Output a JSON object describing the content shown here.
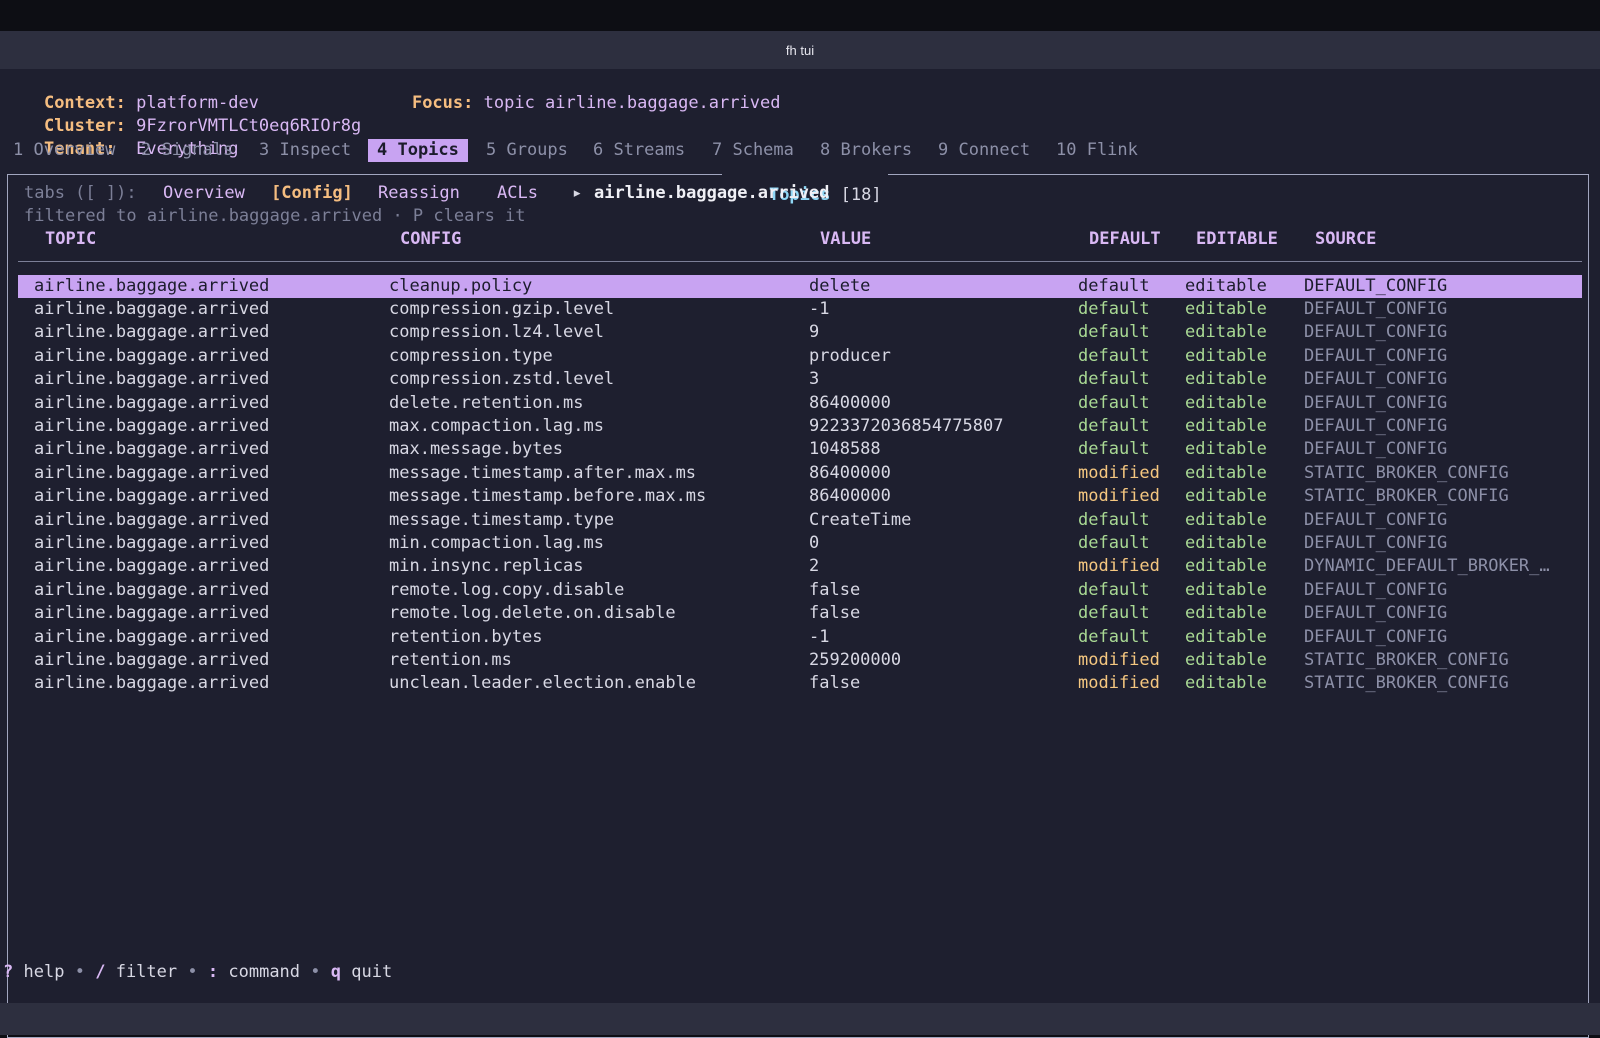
{
  "window": {
    "title": "fh tui"
  },
  "header": {
    "context_label": "Context:",
    "context_value": "platform-dev",
    "focus_label": "Focus:",
    "focus_value": "topic airline.baggage.arrived",
    "cluster_label": "Cluster:",
    "cluster_value": "9FzrorVMTLCt0eq6RIOr8g",
    "tenant_label": "Tenant:",
    "tenant_value": "Everything"
  },
  "nav_tabs": [
    {
      "label": "1 Overview",
      "active": false
    },
    {
      "label": "2 Signals",
      "active": false
    },
    {
      "label": "3 Inspect",
      "active": false
    },
    {
      "label": "4 Topics",
      "active": true
    },
    {
      "label": "5 Groups",
      "active": false
    },
    {
      "label": "6 Streams",
      "active": false
    },
    {
      "label": "7 Schema",
      "active": false
    },
    {
      "label": "8 Brokers",
      "active": false
    },
    {
      "label": "9 Connect",
      "active": false
    },
    {
      "label": "10 Flink",
      "active": false
    }
  ],
  "panel": {
    "title": "Topics",
    "count": "[18]",
    "subtabs_prefix": "tabs ([ ]):",
    "subtabs": [
      {
        "label": "Overview",
        "active": false
      },
      {
        "label": "[Config]",
        "active": true
      },
      {
        "label": "Reassign",
        "active": false
      },
      {
        "label": "ACLs",
        "active": false
      }
    ],
    "breadcrumb_arrow": "▸",
    "breadcrumb_topic": "airline.baggage.arrived",
    "filter_note": "filtered to airline.baggage.arrived · P clears it"
  },
  "table": {
    "columns": [
      "TOPIC",
      "CONFIG",
      "VALUE",
      "DEFAULT",
      "EDITABLE",
      "SOURCE"
    ],
    "selected_index": 0,
    "rows": [
      {
        "topic": "airline.baggage.arrived",
        "config": "cleanup.policy",
        "value": "delete",
        "default": "default",
        "editable": "editable",
        "source": "DEFAULT_CONFIG"
      },
      {
        "topic": "airline.baggage.arrived",
        "config": "compression.gzip.level",
        "value": "-1",
        "default": "default",
        "editable": "editable",
        "source": "DEFAULT_CONFIG"
      },
      {
        "topic": "airline.baggage.arrived",
        "config": "compression.lz4.level",
        "value": "9",
        "default": "default",
        "editable": "editable",
        "source": "DEFAULT_CONFIG"
      },
      {
        "topic": "airline.baggage.arrived",
        "config": "compression.type",
        "value": "producer",
        "default": "default",
        "editable": "editable",
        "source": "DEFAULT_CONFIG"
      },
      {
        "topic": "airline.baggage.arrived",
        "config": "compression.zstd.level",
        "value": "3",
        "default": "default",
        "editable": "editable",
        "source": "DEFAULT_CONFIG"
      },
      {
        "topic": "airline.baggage.arrived",
        "config": "delete.retention.ms",
        "value": "86400000",
        "default": "default",
        "editable": "editable",
        "source": "DEFAULT_CONFIG"
      },
      {
        "topic": "airline.baggage.arrived",
        "config": "max.compaction.lag.ms",
        "value": "9223372036854775807",
        "default": "default",
        "editable": "editable",
        "source": "DEFAULT_CONFIG"
      },
      {
        "topic": "airline.baggage.arrived",
        "config": "max.message.bytes",
        "value": "1048588",
        "default": "default",
        "editable": "editable",
        "source": "DEFAULT_CONFIG"
      },
      {
        "topic": "airline.baggage.arrived",
        "config": "message.timestamp.after.max.ms",
        "value": "86400000",
        "default": "modified",
        "editable": "editable",
        "source": "STATIC_BROKER_CONFIG"
      },
      {
        "topic": "airline.baggage.arrived",
        "config": "message.timestamp.before.max.ms",
        "value": "86400000",
        "default": "modified",
        "editable": "editable",
        "source": "STATIC_BROKER_CONFIG"
      },
      {
        "topic": "airline.baggage.arrived",
        "config": "message.timestamp.type",
        "value": "CreateTime",
        "default": "default",
        "editable": "editable",
        "source": "DEFAULT_CONFIG"
      },
      {
        "topic": "airline.baggage.arrived",
        "config": "min.compaction.lag.ms",
        "value": "0",
        "default": "default",
        "editable": "editable",
        "source": "DEFAULT_CONFIG"
      },
      {
        "topic": "airline.baggage.arrived",
        "config": "min.insync.replicas",
        "value": "2",
        "default": "modified",
        "editable": "editable",
        "source": "DYNAMIC_DEFAULT_BROKER_…"
      },
      {
        "topic": "airline.baggage.arrived",
        "config": "remote.log.copy.disable",
        "value": "false",
        "default": "default",
        "editable": "editable",
        "source": "DEFAULT_CONFIG"
      },
      {
        "topic": "airline.baggage.arrived",
        "config": "remote.log.delete.on.disable",
        "value": "false",
        "default": "default",
        "editable": "editable",
        "source": "DEFAULT_CONFIG"
      },
      {
        "topic": "airline.baggage.arrived",
        "config": "retention.bytes",
        "value": "-1",
        "default": "default",
        "editable": "editable",
        "source": "DEFAULT_CONFIG"
      },
      {
        "topic": "airline.baggage.arrived",
        "config": "retention.ms",
        "value": "259200000",
        "default": "modified",
        "editable": "editable",
        "source": "STATIC_BROKER_CONFIG"
      },
      {
        "topic": "airline.baggage.arrived",
        "config": "unclean.leader.election.enable",
        "value": "false",
        "default": "modified",
        "editable": "editable",
        "source": "STATIC_BROKER_CONFIG"
      }
    ]
  },
  "footer": {
    "help_key": "?",
    "help_label": "help",
    "filter_key": "/",
    "filter_label": "filter",
    "command_key": ":",
    "command_label": "command",
    "quit_key": "q",
    "quit_label": "quit",
    "separator": "•"
  }
}
